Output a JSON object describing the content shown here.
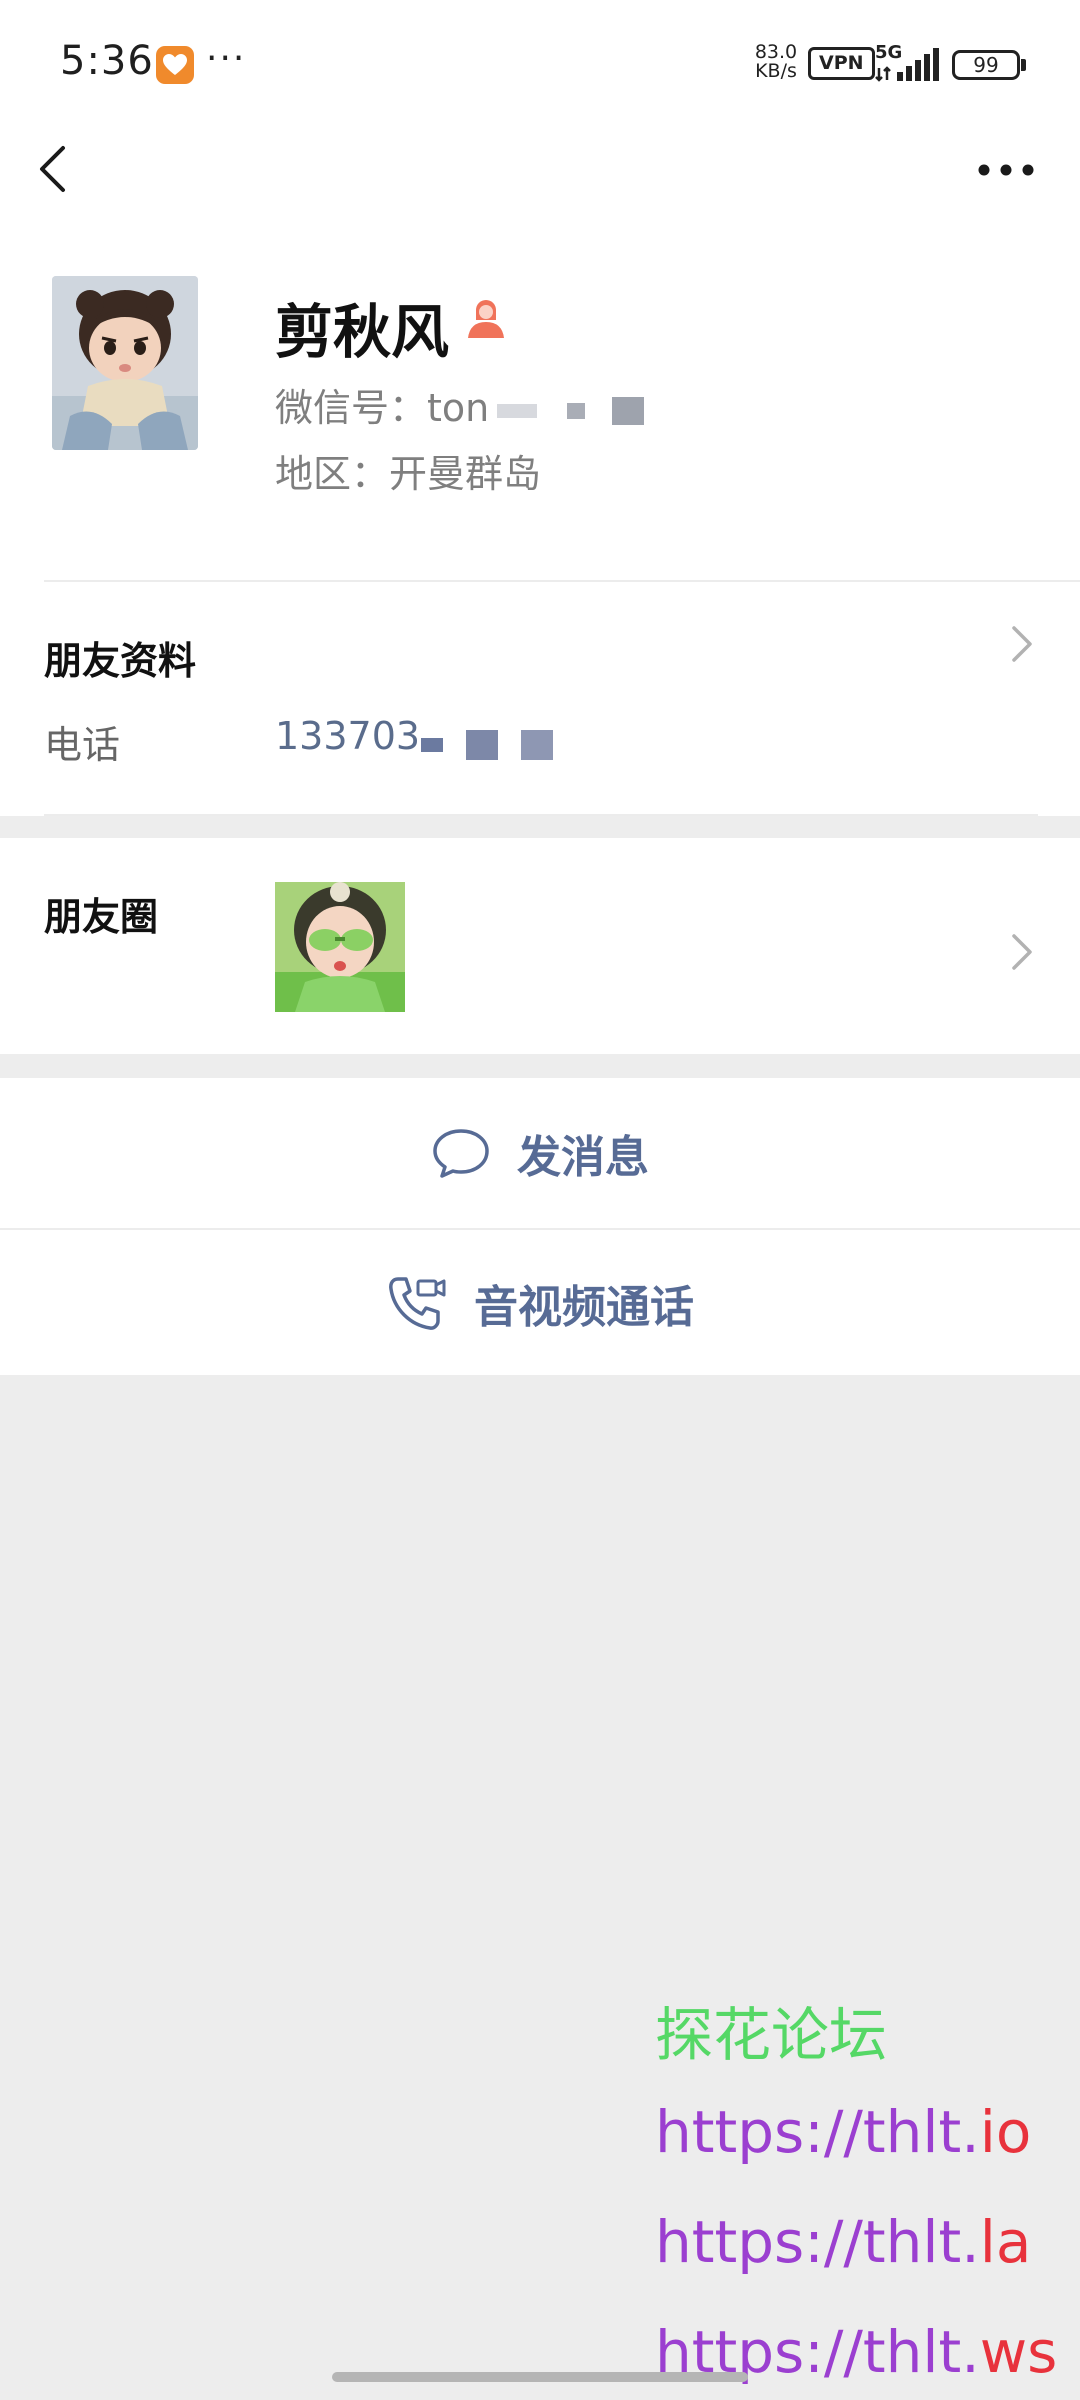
{
  "status_bar": {
    "time": "5:36",
    "net_speed_value": "83.0",
    "net_speed_unit": "KB/s",
    "vpn": "VPN",
    "network": "5G",
    "battery": "99",
    "more": "···",
    "app_icon_color": "#f08a2c"
  },
  "profile": {
    "name": "剪秋风",
    "wechat_id_label": "微信号：",
    "wechat_id_value": "ton",
    "region_label": "地区：",
    "region_value": "开曼群岛",
    "gender_icon": "female-icon",
    "gender_color": "#f0735a"
  },
  "friend_info": {
    "title": "朋友资料",
    "phone_label": "电话",
    "phone_value": "133703"
  },
  "moments": {
    "title": "朋友圈"
  },
  "actions": {
    "message_label": "发消息",
    "call_label": "音视频通话",
    "accent_color": "#576b95"
  },
  "watermark": {
    "title": "探花论坛",
    "links": [
      {
        "prefix": "https://thlt.",
        "suffix": "io"
      },
      {
        "prefix": "https://thlt.",
        "suffix": "la"
      },
      {
        "prefix": "https://thlt.",
        "suffix": "ws"
      }
    ]
  }
}
